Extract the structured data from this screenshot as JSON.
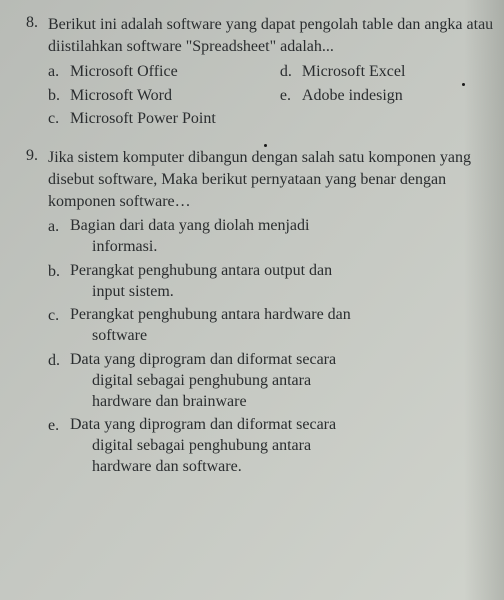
{
  "q8": {
    "number": "8.",
    "text": "Berikut ini adalah software yang dapat pengolah table dan angka atau diistilahkan software \"Spreadsheet\" adalah...",
    "options": {
      "a": {
        "label": "a.",
        "text": "Microsoft Office"
      },
      "b": {
        "label": "b.",
        "text": "Microsoft Word"
      },
      "c": {
        "label": "c.",
        "text": "Microsoft Power Point"
      },
      "d": {
        "label": "d.",
        "text": "Microsoft Excel"
      },
      "e": {
        "label": "e.",
        "text": "Adobe indesign"
      }
    }
  },
  "q9": {
    "number": "9.",
    "text": "Jika sistem komputer dibangun dengan salah satu komponen yang disebut software, Maka berikut pernyataan yang benar dengan komponen software…",
    "options": {
      "a": {
        "label": "a.",
        "line1": "Bagian dari data yang diolah menjadi",
        "line2": "informasi."
      },
      "b": {
        "label": "b.",
        "line1": "Perangkat penghubung antara output dan",
        "line2": "input sistem."
      },
      "c": {
        "label": "c.",
        "line1": "Perangkat penghubung antara hardware dan",
        "line2": "software"
      },
      "d": {
        "label": "d.",
        "line1": "Data yang diprogram dan diformat secara",
        "line2": "digital sebagai penghubung antara",
        "line3": "hardware dan brainware"
      },
      "e": {
        "label": "e.",
        "line1": "Data yang diprogram dan diformat secara",
        "line2": "digital sebagai penghubung antara",
        "line3": "hardware dan software."
      }
    }
  }
}
